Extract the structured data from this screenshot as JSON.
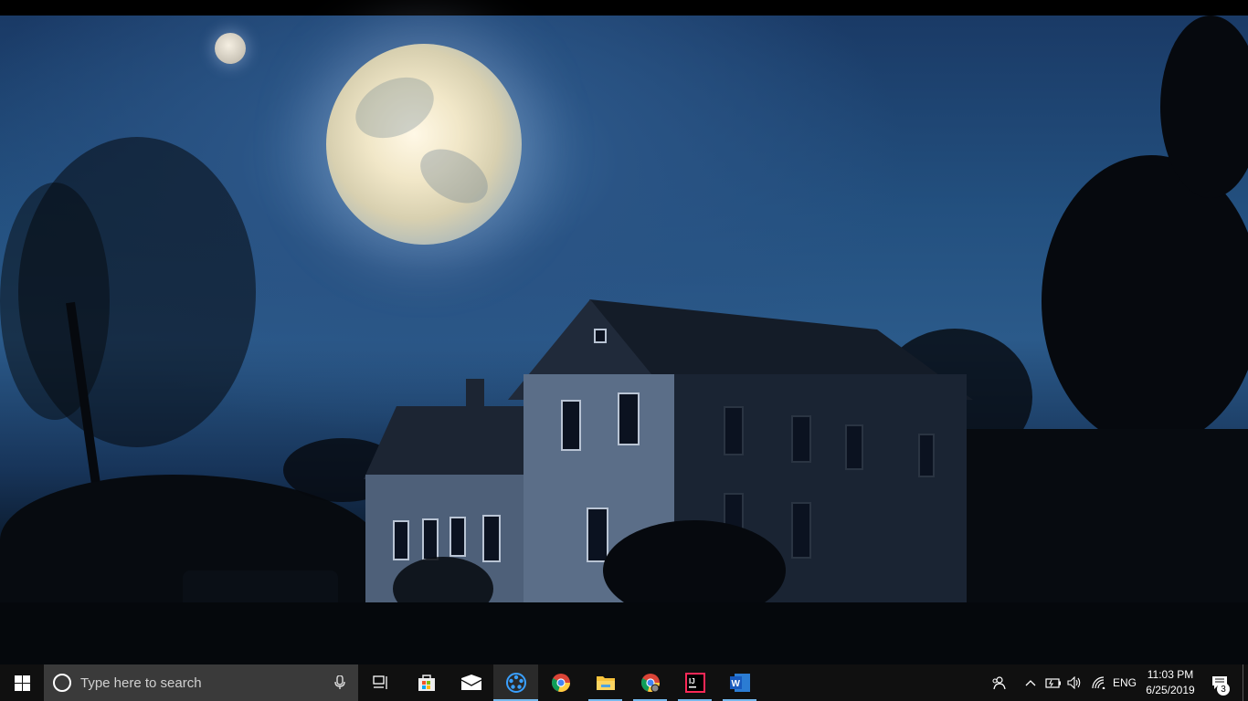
{
  "taskbar": {
    "search_placeholder": "Type here to search",
    "apps": [
      {
        "name": "task-view",
        "icon": "task-view-icon"
      },
      {
        "name": "microsoft-store",
        "icon": "store-icon"
      },
      {
        "name": "mail",
        "icon": "mail-icon"
      },
      {
        "name": "media-player",
        "icon": "film-reel-icon",
        "active": true
      },
      {
        "name": "chrome",
        "icon": "chrome-icon"
      },
      {
        "name": "file-explorer",
        "icon": "folder-icon"
      },
      {
        "name": "chrome-profile",
        "icon": "chrome-icon"
      },
      {
        "name": "intellij-idea",
        "icon": "intellij-icon"
      },
      {
        "name": "word",
        "icon": "word-icon"
      }
    ],
    "tray": {
      "language": "ENG",
      "time": "11:03 PM",
      "date": "6/25/2019",
      "notification_count": "3"
    }
  },
  "colors": {
    "taskbar_bg": "#101010",
    "accent_underline": "#76b9ed",
    "search_bg": "#3a3a3a"
  }
}
